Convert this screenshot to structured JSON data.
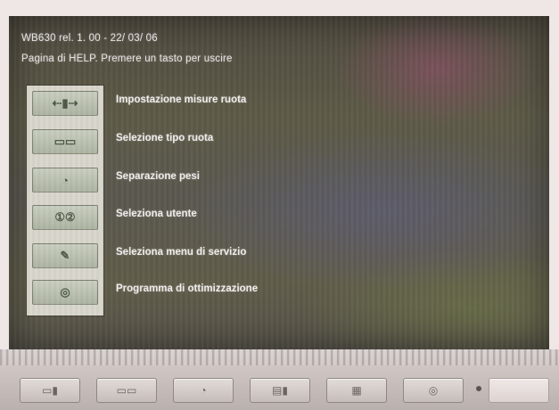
{
  "header": {
    "line1": "WB630  rel. 1. 00  -  22/ 03/ 06",
    "line2": "Pagina di HELP.  Premere un tasto per uscire"
  },
  "menu": {
    "items": [
      {
        "label": "Impostazione misure ruota",
        "icon": "wheel-dimensions-icon",
        "glyph": "⇠▮⇢"
      },
      {
        "label": "Selezione tipo ruota",
        "icon": "wheel-type-icon",
        "glyph": "▭▭"
      },
      {
        "label": "Separazione pesi",
        "icon": "split-weights-icon",
        "glyph": "◔"
      },
      {
        "label": "Seleziona utente",
        "icon": "user-select-icon",
        "glyph": "①②"
      },
      {
        "label": "Seleziona menu di servizio",
        "icon": "service-menu-icon",
        "glyph": "✎"
      },
      {
        "label": "Programma di ottimizzazione",
        "icon": "optimization-icon",
        "glyph": "◎"
      }
    ]
  },
  "function_keys": [
    {
      "icon": "wheel-dimensions-key-icon",
      "glyph": "▭▮"
    },
    {
      "icon": "wheel-type-key-icon",
      "glyph": "▭▭"
    },
    {
      "icon": "split-weights-key-icon",
      "glyph": "◔"
    },
    {
      "icon": "user-select-key-icon",
      "glyph": "▤▮"
    },
    {
      "icon": "service-menu-key-icon",
      "glyph": "▦"
    },
    {
      "icon": "optimization-key-icon",
      "glyph": "◎"
    },
    {
      "icon": "blank-key",
      "glyph": ""
    }
  ],
  "colors": {
    "screen_bg": "#5a584f",
    "text": "#f2eeee",
    "icon_panel": "#d9d6cc"
  }
}
